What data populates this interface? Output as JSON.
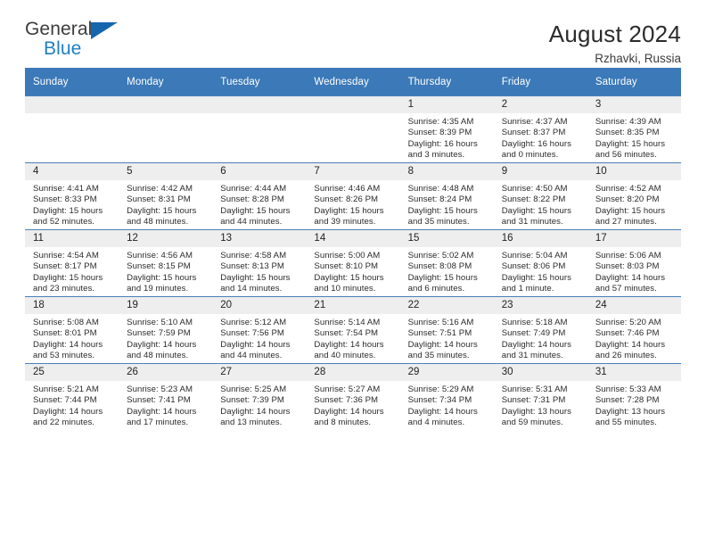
{
  "brand": {
    "name_part1": "General",
    "name_part2": "Blue",
    "triangle_icon": "triangle-icon",
    "accent_color": "#1f7fc4",
    "header_color": "#3b79b8"
  },
  "header": {
    "title": "August 2024",
    "location": "Rzhavki, Russia"
  },
  "calendar": {
    "weekday_headers": [
      "Sunday",
      "Monday",
      "Tuesday",
      "Wednesday",
      "Thursday",
      "Friday",
      "Saturday"
    ],
    "labels": {
      "sunrise": "Sunrise:",
      "sunset": "Sunset:",
      "daylight": "Daylight:"
    },
    "weeks": [
      [
        {
          "day": "",
          "empty": true
        },
        {
          "day": "",
          "empty": true
        },
        {
          "day": "",
          "empty": true
        },
        {
          "day": "",
          "empty": true
        },
        {
          "day": "1",
          "sunrise": "Sunrise: 4:35 AM",
          "sunset": "Sunset: 8:39 PM",
          "daylight_line1": "Daylight: 16 hours",
          "daylight_line2": "and 3 minutes."
        },
        {
          "day": "2",
          "sunrise": "Sunrise: 4:37 AM",
          "sunset": "Sunset: 8:37 PM",
          "daylight_line1": "Daylight: 16 hours",
          "daylight_line2": "and 0 minutes."
        },
        {
          "day": "3",
          "sunrise": "Sunrise: 4:39 AM",
          "sunset": "Sunset: 8:35 PM",
          "daylight_line1": "Daylight: 15 hours",
          "daylight_line2": "and 56 minutes."
        }
      ],
      [
        {
          "day": "4",
          "sunrise": "Sunrise: 4:41 AM",
          "sunset": "Sunset: 8:33 PM",
          "daylight_line1": "Daylight: 15 hours",
          "daylight_line2": "and 52 minutes."
        },
        {
          "day": "5",
          "sunrise": "Sunrise: 4:42 AM",
          "sunset": "Sunset: 8:31 PM",
          "daylight_line1": "Daylight: 15 hours",
          "daylight_line2": "and 48 minutes."
        },
        {
          "day": "6",
          "sunrise": "Sunrise: 4:44 AM",
          "sunset": "Sunset: 8:28 PM",
          "daylight_line1": "Daylight: 15 hours",
          "daylight_line2": "and 44 minutes."
        },
        {
          "day": "7",
          "sunrise": "Sunrise: 4:46 AM",
          "sunset": "Sunset: 8:26 PM",
          "daylight_line1": "Daylight: 15 hours",
          "daylight_line2": "and 39 minutes."
        },
        {
          "day": "8",
          "sunrise": "Sunrise: 4:48 AM",
          "sunset": "Sunset: 8:24 PM",
          "daylight_line1": "Daylight: 15 hours",
          "daylight_line2": "and 35 minutes."
        },
        {
          "day": "9",
          "sunrise": "Sunrise: 4:50 AM",
          "sunset": "Sunset: 8:22 PM",
          "daylight_line1": "Daylight: 15 hours",
          "daylight_line2": "and 31 minutes."
        },
        {
          "day": "10",
          "sunrise": "Sunrise: 4:52 AM",
          "sunset": "Sunset: 8:20 PM",
          "daylight_line1": "Daylight: 15 hours",
          "daylight_line2": "and 27 minutes."
        }
      ],
      [
        {
          "day": "11",
          "sunrise": "Sunrise: 4:54 AM",
          "sunset": "Sunset: 8:17 PM",
          "daylight_line1": "Daylight: 15 hours",
          "daylight_line2": "and 23 minutes."
        },
        {
          "day": "12",
          "sunrise": "Sunrise: 4:56 AM",
          "sunset": "Sunset: 8:15 PM",
          "daylight_line1": "Daylight: 15 hours",
          "daylight_line2": "and 19 minutes."
        },
        {
          "day": "13",
          "sunrise": "Sunrise: 4:58 AM",
          "sunset": "Sunset: 8:13 PM",
          "daylight_line1": "Daylight: 15 hours",
          "daylight_line2": "and 14 minutes."
        },
        {
          "day": "14",
          "sunrise": "Sunrise: 5:00 AM",
          "sunset": "Sunset: 8:10 PM",
          "daylight_line1": "Daylight: 15 hours",
          "daylight_line2": "and 10 minutes."
        },
        {
          "day": "15",
          "sunrise": "Sunrise: 5:02 AM",
          "sunset": "Sunset: 8:08 PM",
          "daylight_line1": "Daylight: 15 hours",
          "daylight_line2": "and 6 minutes."
        },
        {
          "day": "16",
          "sunrise": "Sunrise: 5:04 AM",
          "sunset": "Sunset: 8:06 PM",
          "daylight_line1": "Daylight: 15 hours",
          "daylight_line2": "and 1 minute."
        },
        {
          "day": "17",
          "sunrise": "Sunrise: 5:06 AM",
          "sunset": "Sunset: 8:03 PM",
          "daylight_line1": "Daylight: 14 hours",
          "daylight_line2": "and 57 minutes."
        }
      ],
      [
        {
          "day": "18",
          "sunrise": "Sunrise: 5:08 AM",
          "sunset": "Sunset: 8:01 PM",
          "daylight_line1": "Daylight: 14 hours",
          "daylight_line2": "and 53 minutes."
        },
        {
          "day": "19",
          "sunrise": "Sunrise: 5:10 AM",
          "sunset": "Sunset: 7:59 PM",
          "daylight_line1": "Daylight: 14 hours",
          "daylight_line2": "and 48 minutes."
        },
        {
          "day": "20",
          "sunrise": "Sunrise: 5:12 AM",
          "sunset": "Sunset: 7:56 PM",
          "daylight_line1": "Daylight: 14 hours",
          "daylight_line2": "and 44 minutes."
        },
        {
          "day": "21",
          "sunrise": "Sunrise: 5:14 AM",
          "sunset": "Sunset: 7:54 PM",
          "daylight_line1": "Daylight: 14 hours",
          "daylight_line2": "and 40 minutes."
        },
        {
          "day": "22",
          "sunrise": "Sunrise: 5:16 AM",
          "sunset": "Sunset: 7:51 PM",
          "daylight_line1": "Daylight: 14 hours",
          "daylight_line2": "and 35 minutes."
        },
        {
          "day": "23",
          "sunrise": "Sunrise: 5:18 AM",
          "sunset": "Sunset: 7:49 PM",
          "daylight_line1": "Daylight: 14 hours",
          "daylight_line2": "and 31 minutes."
        },
        {
          "day": "24",
          "sunrise": "Sunrise: 5:20 AM",
          "sunset": "Sunset: 7:46 PM",
          "daylight_line1": "Daylight: 14 hours",
          "daylight_line2": "and 26 minutes."
        }
      ],
      [
        {
          "day": "25",
          "sunrise": "Sunrise: 5:21 AM",
          "sunset": "Sunset: 7:44 PM",
          "daylight_line1": "Daylight: 14 hours",
          "daylight_line2": "and 22 minutes."
        },
        {
          "day": "26",
          "sunrise": "Sunrise: 5:23 AM",
          "sunset": "Sunset: 7:41 PM",
          "daylight_line1": "Daylight: 14 hours",
          "daylight_line2": "and 17 minutes."
        },
        {
          "day": "27",
          "sunrise": "Sunrise: 5:25 AM",
          "sunset": "Sunset: 7:39 PM",
          "daylight_line1": "Daylight: 14 hours",
          "daylight_line2": "and 13 minutes."
        },
        {
          "day": "28",
          "sunrise": "Sunrise: 5:27 AM",
          "sunset": "Sunset: 7:36 PM",
          "daylight_line1": "Daylight: 14 hours",
          "daylight_line2": "and 8 minutes."
        },
        {
          "day": "29",
          "sunrise": "Sunrise: 5:29 AM",
          "sunset": "Sunset: 7:34 PM",
          "daylight_line1": "Daylight: 14 hours",
          "daylight_line2": "and 4 minutes."
        },
        {
          "day": "30",
          "sunrise": "Sunrise: 5:31 AM",
          "sunset": "Sunset: 7:31 PM",
          "daylight_line1": "Daylight: 13 hours",
          "daylight_line2": "and 59 minutes."
        },
        {
          "day": "31",
          "sunrise": "Sunrise: 5:33 AM",
          "sunset": "Sunset: 7:28 PM",
          "daylight_line1": "Daylight: 13 hours",
          "daylight_line2": "and 55 minutes."
        }
      ]
    ]
  }
}
